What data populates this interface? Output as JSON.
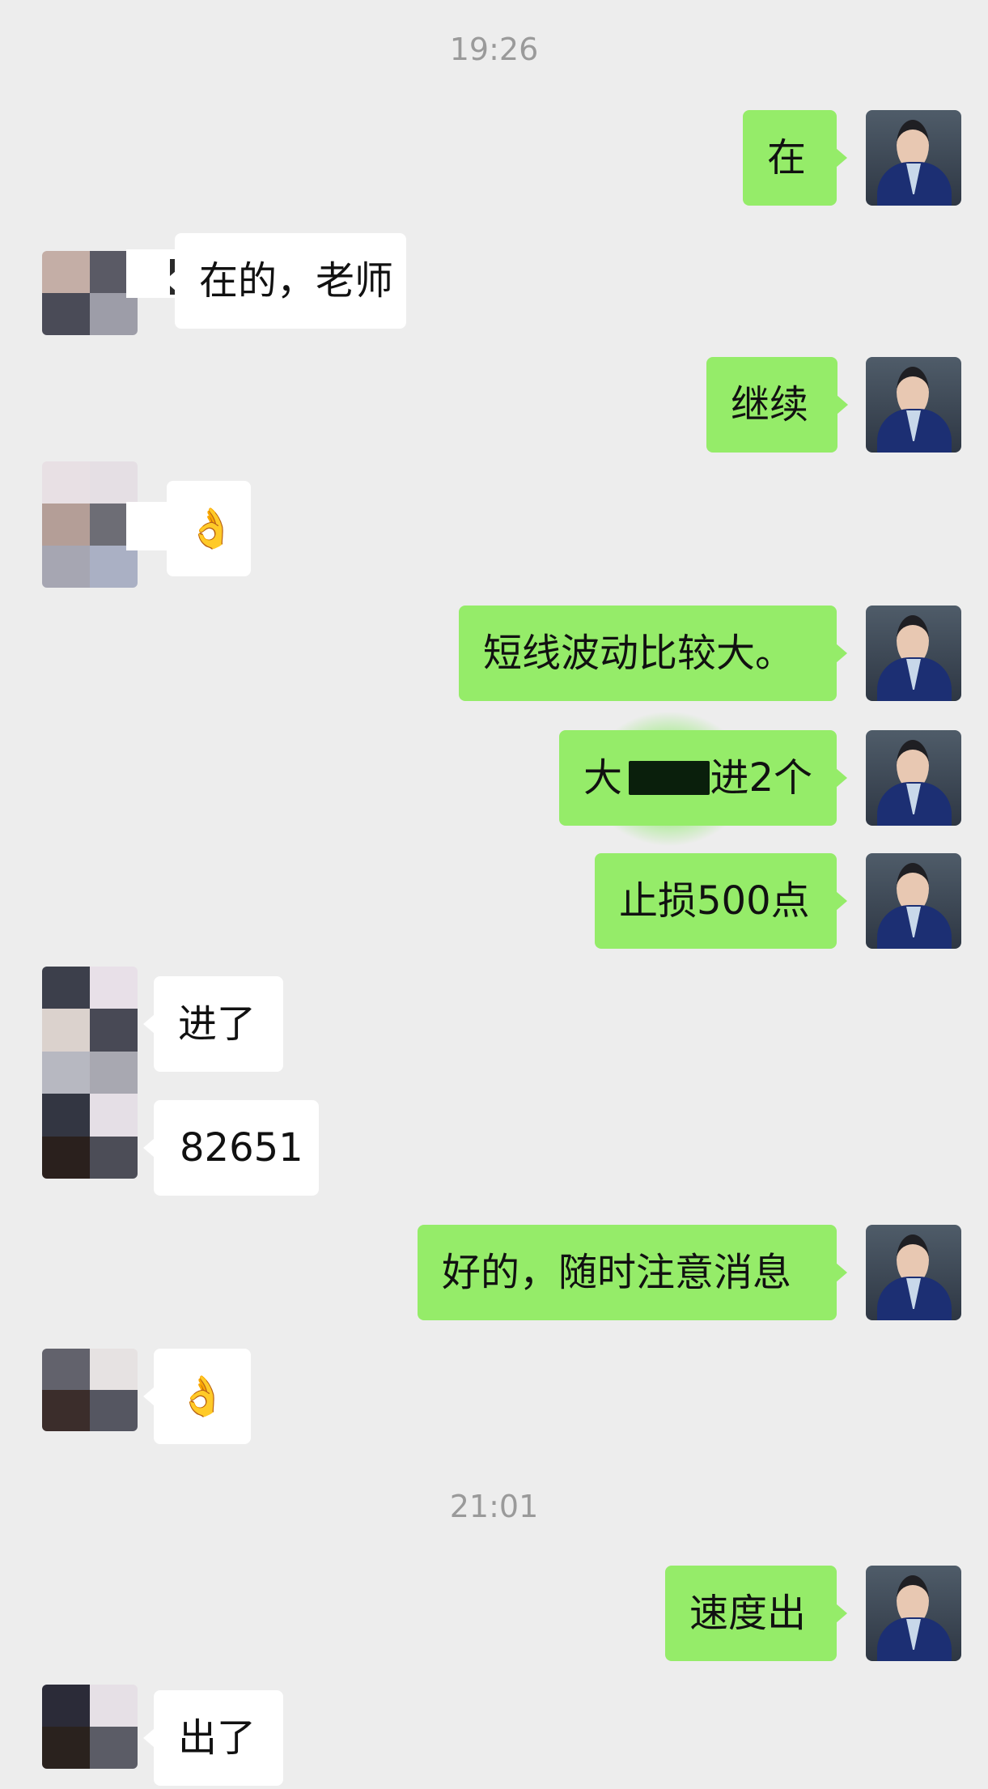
{
  "timestamps": {
    "first": "19:26",
    "second": "21:01"
  },
  "messages": [
    {
      "sender": "me",
      "text": "在"
    },
    {
      "sender": "other",
      "text": "在的，老师"
    },
    {
      "sender": "me",
      "text": "继续"
    },
    {
      "sender": "other",
      "text": "👌"
    },
    {
      "sender": "me",
      "text": "短线波动比较大。"
    },
    {
      "sender": "me",
      "text_before": "大",
      "text_after": "进2个"
    },
    {
      "sender": "me",
      "text": "止损500点"
    },
    {
      "sender": "other",
      "text": "进了"
    },
    {
      "sender": "other",
      "text": "82651"
    },
    {
      "sender": "me",
      "text": "好的，随时注意消息"
    },
    {
      "sender": "other",
      "text": "👌"
    },
    {
      "sender": "me",
      "text": "速度出"
    },
    {
      "sender": "other",
      "text": "出了"
    }
  ],
  "colors": {
    "background": "#ededed",
    "me_bubble": "#95ec69",
    "other_bubble": "#ffffff",
    "timestamp_text": "#9a9a9a"
  },
  "icons": {
    "me_avatar": "man-in-suit-avatar",
    "other_avatar": "mosaic-pixelated-avatar",
    "redaction": "green-blob-redaction"
  }
}
